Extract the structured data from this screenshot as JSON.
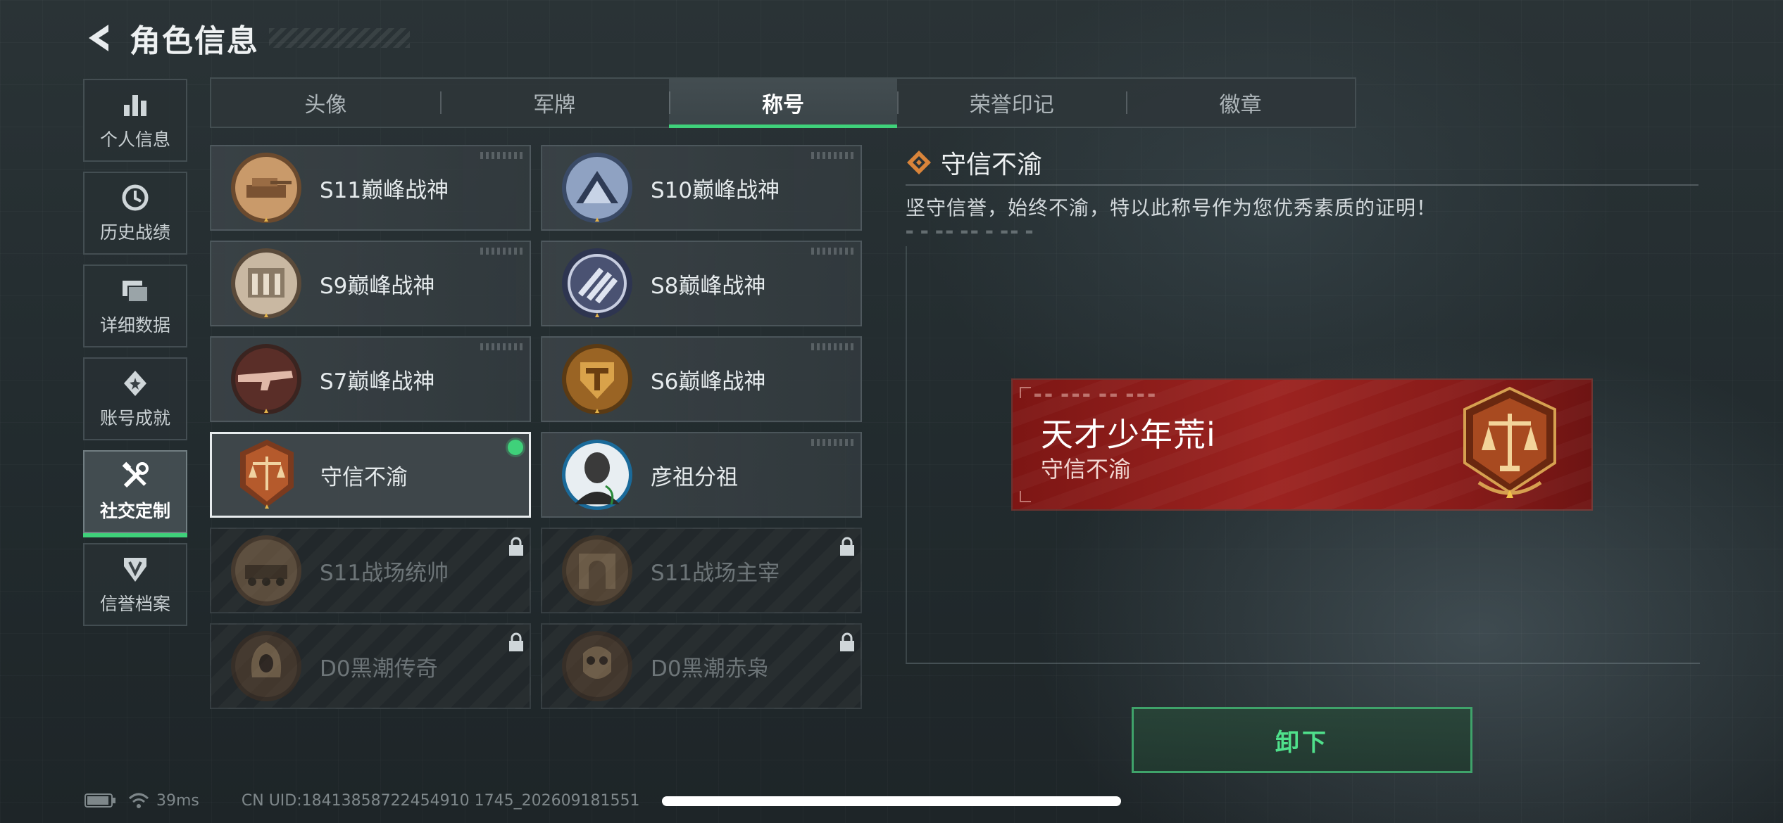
{
  "header": {
    "title": "角色信息"
  },
  "nav": {
    "items": [
      {
        "label": "个人信息",
        "icon": "bar-chart-icon"
      },
      {
        "label": "历史战绩",
        "icon": "clock-icon"
      },
      {
        "label": "详细数据",
        "icon": "folder-icon"
      },
      {
        "label": "账号成就",
        "icon": "achievement-icon"
      },
      {
        "label": "社交定制",
        "icon": "tools-icon",
        "active": true
      },
      {
        "label": "信誉档案",
        "icon": "shield-icon"
      }
    ]
  },
  "tabs": [
    {
      "label": "头像"
    },
    {
      "label": "军牌"
    },
    {
      "label": "称号",
      "active": true
    },
    {
      "label": "荣誉印记"
    },
    {
      "label": "徽章"
    }
  ],
  "titles": [
    {
      "name": "S11巅峰战神",
      "icon": "tank-medal-icon",
      "state": "owned"
    },
    {
      "name": "S10巅峰战神",
      "icon": "station-medal-icon",
      "state": "owned"
    },
    {
      "name": "S9巅峰战神",
      "icon": "building-medal-icon",
      "state": "owned"
    },
    {
      "name": "S8巅峰战神",
      "icon": "stripes-medal-icon",
      "state": "owned"
    },
    {
      "name": "S7巅峰战神",
      "icon": "rifle-medal-icon",
      "state": "owned"
    },
    {
      "name": "S6巅峰战神",
      "icon": "t-shield-medal-icon",
      "state": "owned"
    },
    {
      "name": "守信不渝",
      "icon": "scales-medal-icon",
      "state": "equipped"
    },
    {
      "name": "彦祖分祖",
      "icon": "portrait-avatar-icon",
      "state": "owned"
    },
    {
      "name": "S11战场统帅",
      "icon": "vehicle-medal-icon",
      "state": "locked"
    },
    {
      "name": "S11战场主宰",
      "icon": "arch-medal-icon",
      "state": "locked"
    },
    {
      "name": "D0黑潮传奇",
      "icon": "hooded-figure-medal-icon",
      "state": "locked"
    },
    {
      "name": "D0黑潮赤枭",
      "icon": "skull-mask-medal-icon",
      "state": "locked"
    }
  ],
  "detail": {
    "title": "守信不渝",
    "description": "坚守信誉，始终不渝，特以此称号作为您优秀素质的证明！"
  },
  "banner": {
    "player_name": "天才少年荒i",
    "title_text": "守信不渝",
    "medal_icon": "scales-medal-icon"
  },
  "actions": {
    "unequip_label": "卸下"
  },
  "status": {
    "ping": "39ms",
    "uid": "CN UID:18413858722454910 1745_202609181551"
  },
  "colors": {
    "accent": "#3fd17a",
    "banner_red": "#9c2320"
  }
}
